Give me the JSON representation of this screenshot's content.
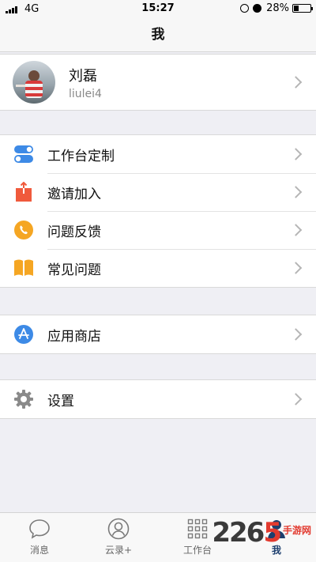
{
  "status_bar": {
    "carrier": "4G",
    "time": "15:27",
    "battery": "28%",
    "battery_level": 0.28
  },
  "header": {
    "title": "我"
  },
  "profile": {
    "name": "刘磊",
    "username": "liulei4"
  },
  "menu_group1": {
    "items": [
      {
        "label": "工作台定制",
        "icon": "toggle-icon",
        "color": "#3d8ae6"
      },
      {
        "label": "邀请加入",
        "icon": "share-box-icon",
        "color": "#f05a3c"
      },
      {
        "label": "问题反馈",
        "icon": "phone-icon",
        "color": "#f5a623"
      },
      {
        "label": "常见问题",
        "icon": "book-icon",
        "color": "#f5a623"
      }
    ]
  },
  "menu_group2": {
    "items": [
      {
        "label": "应用商店",
        "icon": "app-store-icon",
        "color": "#3d8ae6"
      }
    ]
  },
  "menu_group3": {
    "items": [
      {
        "label": "设置",
        "icon": "gear-icon",
        "color": "#8a8a8a"
      }
    ]
  },
  "tab_bar": {
    "tabs": [
      {
        "label": "消息",
        "icon": "chat-icon",
        "active": false
      },
      {
        "label": "云录+",
        "icon": "contact-icon",
        "active": false
      },
      {
        "label": "工作台",
        "icon": "grid-icon",
        "active": false
      },
      {
        "label": "我",
        "icon": "person-icon",
        "active": true
      }
    ]
  },
  "watermark": {
    "number_a": "226",
    "number_b": "5",
    "site": "手游网"
  }
}
